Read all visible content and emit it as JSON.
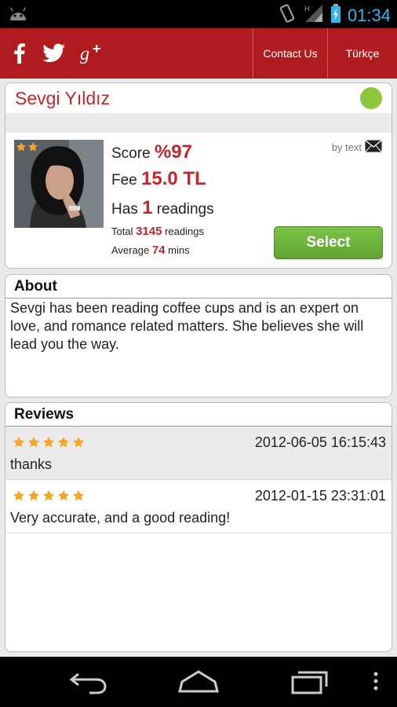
{
  "status_bar": {
    "time": "01:34",
    "network": "H"
  },
  "header": {
    "social_icons": [
      "facebook-icon",
      "twitter-icon",
      "google-plus-icon"
    ],
    "contact_label": "Contact Us",
    "language_label": "Türkçe",
    "brand_color": "#b01b1f"
  },
  "profile": {
    "name": "Sevgi Yıldız",
    "online_color": "#8dc63f",
    "score_label": "Score",
    "score_value": "%97",
    "fee_label": "Fee",
    "fee_value": "15.0 TL",
    "has_label": "Has",
    "has_value": "1",
    "readings_label": "readings",
    "total_label": "Total",
    "total_value": "3145",
    "total_suffix": "readings",
    "average_label": "Average",
    "average_value": "74",
    "average_suffix": "mins",
    "by_text": "by text",
    "select_label": "Select",
    "rating_stars": 2
  },
  "about": {
    "title": "About",
    "text": "Sevgi has been reading coffee cups and is an expert on love, and romance related matters. She believes she will lead you the way."
  },
  "reviews": {
    "title": "Reviews",
    "items": [
      {
        "stars": 5,
        "date": "2012-06-05 16:15:43",
        "text": "thanks"
      },
      {
        "stars": 5,
        "date": "2012-01-15 23:31:01",
        "text": "Very accurate, and a good reading!"
      }
    ]
  }
}
